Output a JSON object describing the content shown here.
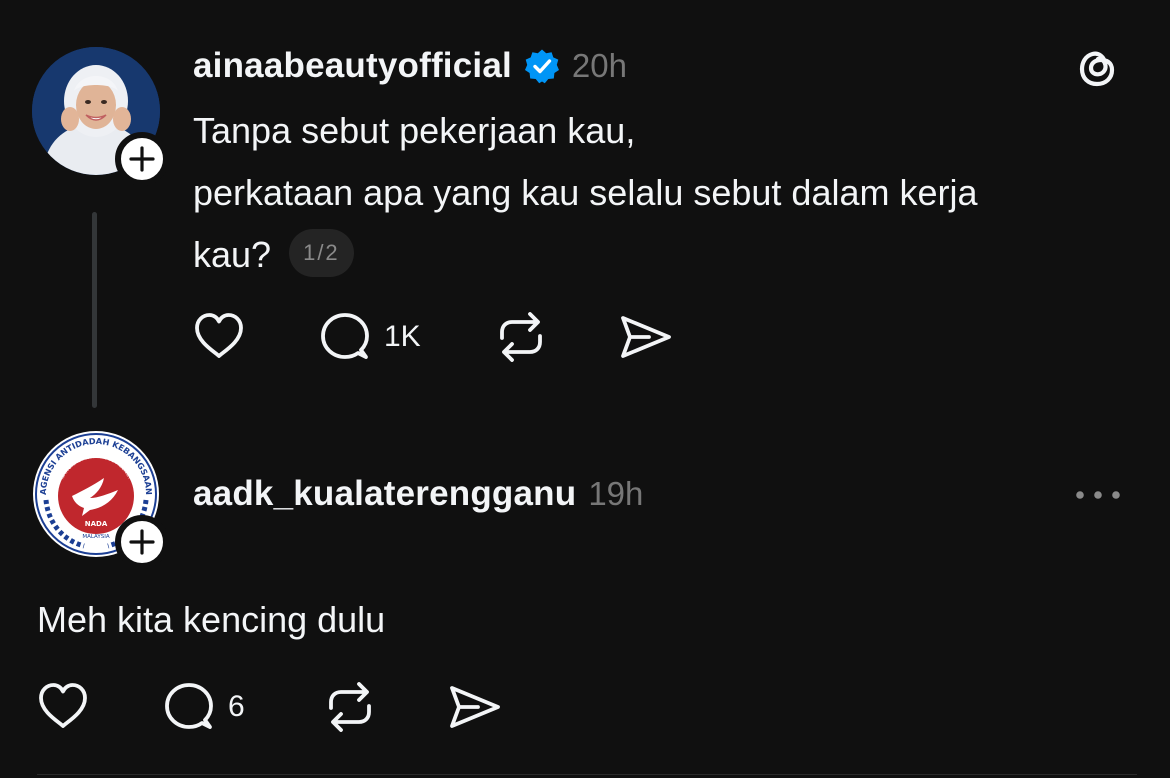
{
  "post1": {
    "username": "ainaabeautyofficial",
    "timestamp": "20h",
    "text_lines": [
      "Tanpa sebut pekerjaan kau,",
      "perkataan apa yang kau selalu sebut dalam kerja",
      "kau?"
    ],
    "page_indicator": "1/2",
    "reply_count": "1K",
    "verified": true
  },
  "post2": {
    "username": "aadk_kualaterengganu",
    "timestamp": "19h",
    "text": "Meh kita kencing dulu",
    "reply_count": "6",
    "avatar_logo": {
      "ring_text": "AGENSI ANTIDADAH KEBANGSAAN",
      "inner_text": "NATIONAL ANTI-DRUGS AGENCY",
      "bottom_text": "NADA",
      "country_text": "MALAYSIA"
    }
  },
  "icons": {
    "like": "heart-icon",
    "reply": "comment-icon",
    "repost": "repost-icon",
    "share": "share-icon",
    "app": "threads-logo-icon",
    "more": "more-horizontal-icon"
  },
  "colors": {
    "background": "#101010",
    "text": "#f3f5f7",
    "muted": "#777777",
    "verified": "#0095f6",
    "thread_line": "#333638"
  }
}
